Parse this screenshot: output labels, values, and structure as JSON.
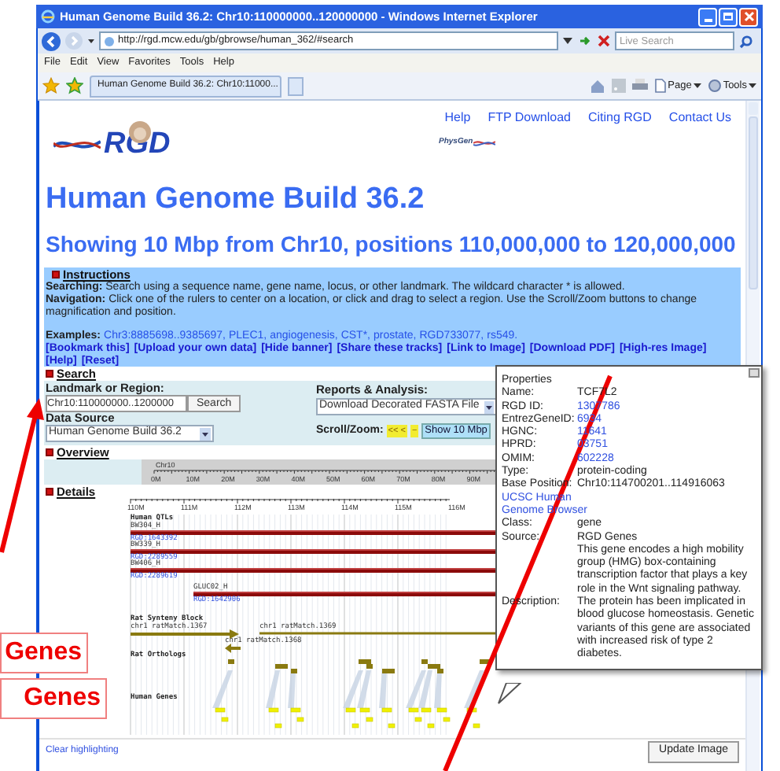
{
  "window": {
    "title": "Human Genome Build 36.2: Chr10:110000000..120000000 - Windows Internet Explorer",
    "address": "http://rgd.mcw.edu/gb/gbrowse/human_362/#search",
    "search_placeholder": "Live Search",
    "menu": [
      "File",
      "Edit",
      "View",
      "Favorites",
      "Tools",
      "Help"
    ],
    "tab": "Human Genome Build 36.2: Chr10:11000...",
    "toolbar": [
      "Page",
      "Tools"
    ]
  },
  "header_links": [
    "Help",
    "FTP Download",
    "Citing RGD",
    "Contact Us"
  ],
  "logo_text": "RGD",
  "partner_logo": "PhysGen",
  "title": "Human Genome Build 36.2",
  "subtitle": "Showing 10 Mbp from Chr10, positions 110,000,000 to 120,000,000",
  "instructions": {
    "heading": "Instructions",
    "paragraphs": [
      "**Searching:** Search using a sequence name, gene name, locus, or other landmark. The wildcard character * is allowed.",
      "**Navigation:** Click one of the rulers to center on a location, or click and drag to select a region. Use the Scroll/Zoom buttons to change magnification and position."
    ],
    "examples_label": "Examples:",
    "examples": [
      "Chr3:8885698..9385697,",
      "PLEC1,",
      "angiogenesis,",
      "CST*,",
      "prostate,",
      "RGD733077,",
      "rs549."
    ],
    "actions": [
      "[Bookmark this]",
      "[Upload your own data]",
      "[Hide banner]",
      "[Share these tracks]",
      "[Link to Image]",
      "[Download PDF]",
      "[High-res Image]",
      "[Help]",
      "[Reset]"
    ]
  },
  "search": {
    "heading": "Search",
    "landmark_label": "Landmark or Region:",
    "landmark_value": "Chr10:110000000..1200000",
    "button": "Search",
    "data_source_label": "Data Source",
    "data_source": "Human Genome Build 36.2",
    "reports_label": "Reports & Analysis:",
    "reports_value": "Download Decorated FASTA File",
    "scroll_label": "Scroll/Zoom:",
    "scroll_buttons": [
      "<< <",
      "−"
    ],
    "zoom_value": "Show 10 Mbp"
  },
  "overview": {
    "heading": "Overview",
    "chromosome": "Chr10",
    "ticks": [
      "0M",
      "10M",
      "20M",
      "30M",
      "40M",
      "50M",
      "60M",
      "70M",
      "80M",
      "90M"
    ]
  },
  "details": {
    "heading": "Details",
    "ticks": [
      "110M",
      "111M",
      "112M",
      "113M",
      "114M",
      "115M",
      "116M"
    ],
    "tracks": [
      {
        "kind": "qtl",
        "label": "Human QTLs",
        "features": [
          {
            "name": "BW304_H",
            "id": "RGD:1643392"
          },
          {
            "name": "BW339_H",
            "id": "RGD:2289559"
          },
          {
            "name": "BW406_H",
            "id": "RGD:2289619"
          },
          {
            "name": "GLUC02_H",
            "id": "RGD:1642906"
          }
        ]
      },
      {
        "kind": "synteny",
        "label": "Rat Synteny Block",
        "features": [
          {
            "name": "chr1 ratMatch.1367"
          },
          {
            "name": "chr1 ratMatch.1369"
          },
          {
            "name": "chr1 ratMatch.1368"
          }
        ]
      },
      {
        "kind": "orthologs",
        "label": "Rat Orthologs"
      },
      {
        "kind": "genes",
        "label": "Human Genes"
      }
    ]
  },
  "clear_link": "Clear highlighting",
  "update_button": "Update Image",
  "popup": {
    "title": "Properties",
    "rows": [
      {
        "kind": "text",
        "label": "Name:",
        "value": "TCF7L2"
      },
      {
        "kind": "link",
        "label": "RGD ID:",
        "value": "1307786"
      },
      {
        "kind": "link",
        "label": "EntrezGeneID:",
        "value": "6934"
      },
      {
        "kind": "link",
        "label": "HGNC:",
        "value": "11641"
      },
      {
        "kind": "link",
        "label": "HPRD:",
        "value": "03751"
      },
      {
        "kind": "link",
        "label": "OMIM:",
        "value": "602228"
      },
      {
        "kind": "text",
        "label": "Type:",
        "value": "protein-coding"
      },
      {
        "kind": "text",
        "label": "Base Position:",
        "value": "Chr10:114700201..114916063"
      },
      {
        "kind": "wide_link",
        "label": "UCSC Human Genome Browser"
      },
      {
        "kind": "text",
        "label": "Class:",
        "value": "gene"
      },
      {
        "kind": "text",
        "label": "Source:",
        "value": "RGD Genes"
      },
      {
        "kind": "text",
        "label": "Description:",
        "value": "This gene encodes a high mobility group (HMG) box-containing transcription factor that plays a key role in the Wnt signaling pathway. The protein has been implicated in blood glucose homeostasis. Genetic variants of this gene are associated with increased risk of type 2 diabetes."
      }
    ]
  },
  "callouts": [
    "Genes",
    "Genes"
  ]
}
